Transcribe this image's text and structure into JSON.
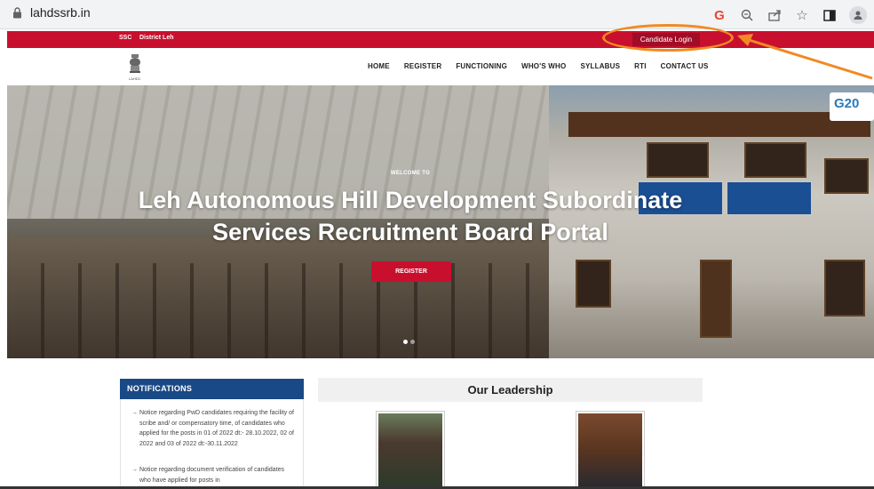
{
  "browser": {
    "url": "lahdssrb.in",
    "icons": [
      "google-icon",
      "zoom-icon",
      "share-icon",
      "bookmark-star-icon",
      "sidebar-icon",
      "profile-icon"
    ]
  },
  "topbar": {
    "links": [
      "SSC",
      "District Leh"
    ],
    "candidate_login": "Candidate Login",
    "color": "#c8102e"
  },
  "header": {
    "logo_caption": "LAHDC",
    "nav": [
      "HOME",
      "REGISTER",
      "FUNCTIONING",
      "WHO'S WHO",
      "SYLLABUS",
      "RTI",
      "CONTACT US"
    ]
  },
  "hero": {
    "welcome": "WELCOME TO",
    "title_line1": "Leh Autonomous Hill Development Subordinate",
    "title_line2": "Services Recruitment Board Portal",
    "register_label": "REGISTER",
    "badge": "G20",
    "slides_count": 2,
    "active_slide": 0
  },
  "notifications": {
    "title": "NOTIFICATIONS",
    "items": [
      "Notice regarding PwD candidates requiring the facility of scribe and/ or compensatory time, of candidates who applied for the posts in 01 of 2022 dt:- 28.10.2022, 02 of 2022 and 03 of 2022 dt:-30.11.2022",
      "Notice regarding document verification of candidates who have applied for posts in"
    ]
  },
  "leadership": {
    "title": "Our Leadership"
  },
  "colors": {
    "accent_red": "#c8102e",
    "notif_blue": "#1a4a86",
    "annotation_orange": "#f08a24"
  }
}
